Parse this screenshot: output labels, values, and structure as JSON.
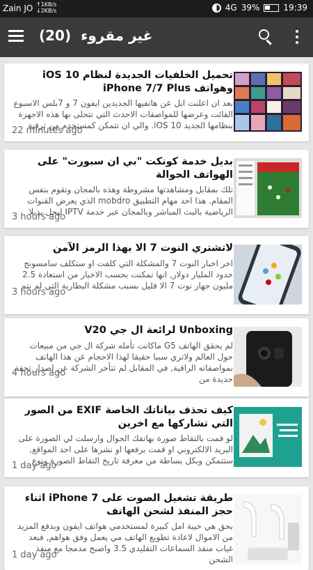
{
  "status_bar": {
    "carrier": "Zain JO",
    "speed_up": "↑1KB/s",
    "speed_down": "↓2KB/s",
    "network": "4G",
    "battery": "39%",
    "time": "19:39"
  },
  "app_bar": {
    "title": "غير مقروء",
    "count": "(20)"
  },
  "articles": [
    {
      "headline": "تحميل الخلفيات الجديدة لنظام iOS 10 وهواتف iPhone 7/7 Plus",
      "summary": "بعد ان اعلنت ابل عن هاتفيها الجديدين ايفون 7 و 7بلس الاسبوع الفائت وعرضها للمواصفات الاحدث التي تتحلى بها هذه الاجهزة بنظامها الجديد iOS 10. والي ان تتمكن كمستخدم من ترقية",
      "time": "22 minutes ago"
    },
    {
      "headline": "بديل خدمة كونكت \"بي ان سبورت\" على الهواتف الجوالة",
      "summary": "تلك بمقابل ومشاهدتها مشروطة وهذه بالمجان وتقوم بنفس المقام. هذا احد مهام التطبيق mobdro الذي يعرض القنوات الرياضية بالبث المباشر وبالمجان عبر خدمة IPTV ليحل بديلا",
      "time": "3 hours ago"
    },
    {
      "headline": "لاتشتري النوت 7 الا بهذا الرمز الآمن",
      "summary": "اخر اخبار النوت 7 والمشكلة التي كلفت او ستكلف سامسونج حدود المليار دولار, انها تمكنت بحسب الاخبار من استعادة 2.5 مليون جهاز نوت 7 الا قليل بسبب مشكلة البطارية التي لم يتم",
      "time": "3 hours ago"
    },
    {
      "headline": "Unboxing لرائعة ال جي V20",
      "summary": "لم يحقق الهاتف G5 ماكانت تأمله شركة ال جي من مبيعات حول العالم ولاتري سببا حقيقا لهذا الاحجام عن هذا الهاتف بمواصفاته الراقية, في المقابل لم تتأخر الشركة عن اصدار تحفة جديدة من",
      "time": "4 hours ago"
    },
    {
      "headline": "كيف تحذف بياناتك الخاصة EXIF من الصور التي تشاركها مع اخرين",
      "summary": "لو قمت بالتقاط صورة بهاتفك الجوال وارسلت لي الصورة على البريد الالكتروني او قمت برفعها او نشرها على احد المواقع, ستتمكن وبكل بساطة من معرفة تاريخ التقاط الصورة ونوع",
      "time": "1 day ago"
    },
    {
      "headline": "طريقة تشغيل الصوت على iPhone 7 اثناء حجز المنفذ لشحن الهاتف",
      "summary": "بحق هي خيبة امل كبيرة لمستخدمي هواتف ايفون وبدفع المزيد من الاموال لاعادة تطويع الهاتف مي يعمل وفق هواهم, فبعد غياب منفذ السماعات التقليدي 3.5 واصبح مدمجا مع منفذ الشحن",
      "time": "1 day ago"
    }
  ]
}
